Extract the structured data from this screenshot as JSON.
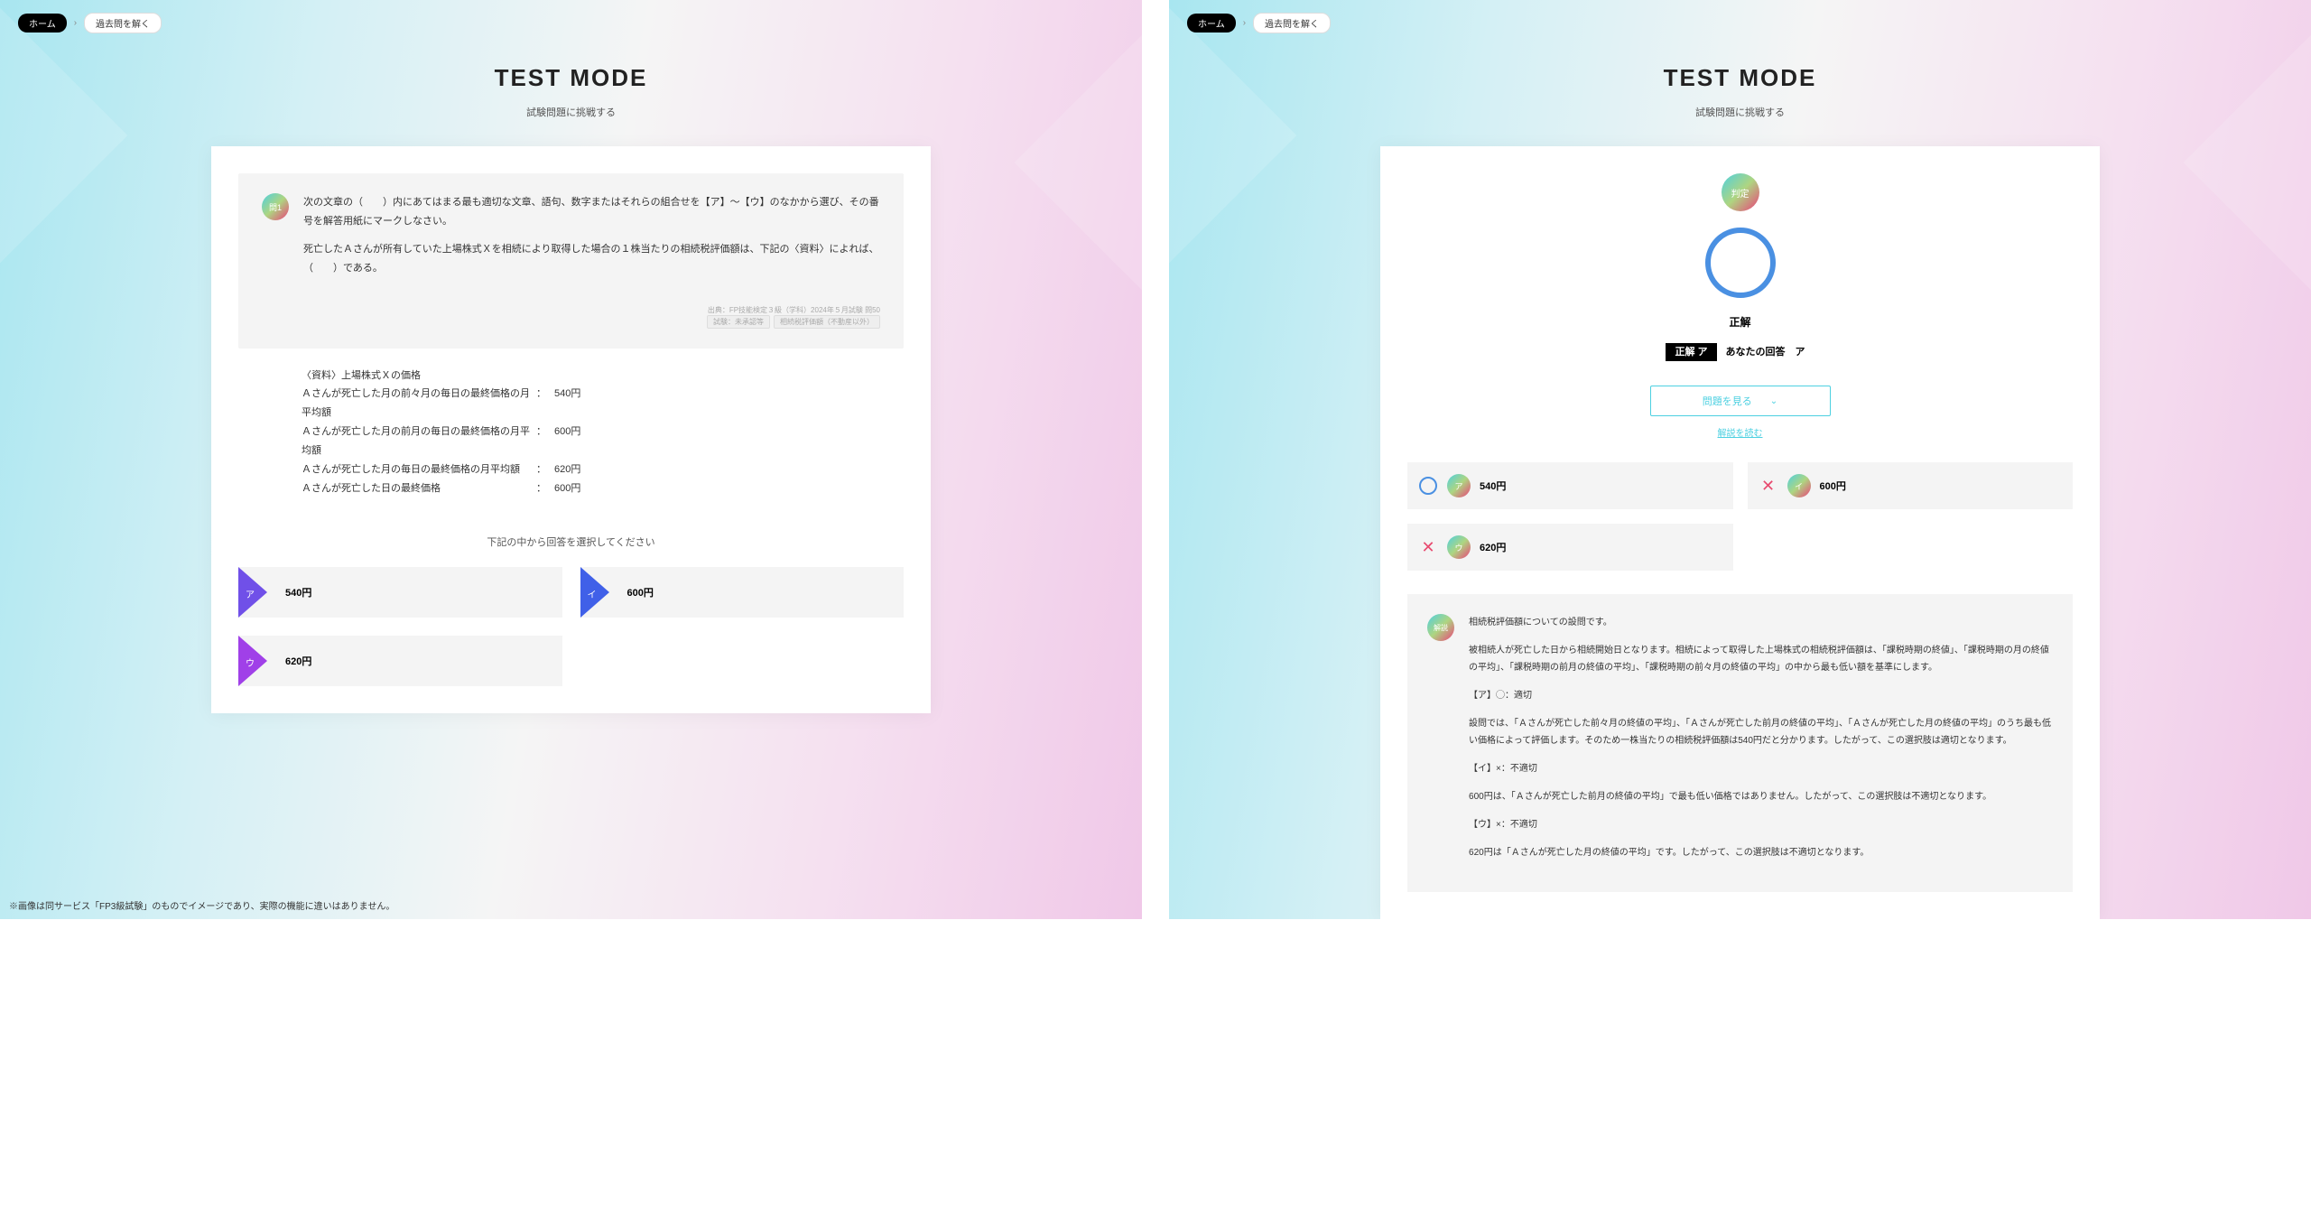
{
  "breadcrumb": {
    "home": "ホーム",
    "current": "過去問を解く"
  },
  "header": {
    "title": "TEST MODE",
    "subtitle": "試験問題に挑戦する"
  },
  "question": {
    "badge": "問1",
    "p1": "次の文章の（　　）内にあてはまる最も適切な文章、語句、数字またはそれらの組合せを【ア】〜【ウ】のなかから選び、その番号を解答用紙にマークしなさい。",
    "p2": "死亡したＡさんが所有していた上場株式Ｘを相続により取得した場合の１株当たりの相続税評価額は、下記の〈資料〉によれば、（　　）である。",
    "meta1": "出典：FP技能検定３級（学科）2024年５月試験 問50",
    "meta2": "試験：未承認等",
    "meta3": "相続税評価額（不動産以外）"
  },
  "data": {
    "title": "〈資料〉上場株式Ｘの価格",
    "rows": [
      {
        "label": "Ａさんが死亡した月の前々月の毎日の最終価格の月平均額",
        "value": "540円"
      },
      {
        "label": "Ａさんが死亡した月の前月の毎日の最終価格の月平均額",
        "value": "600円"
      },
      {
        "label": "Ａさんが死亡した月の毎日の最終価格の月平均額",
        "value": "620円"
      },
      {
        "label": "Ａさんが死亡した日の最終価格",
        "value": "600円"
      }
    ]
  },
  "prompt": "下記の中から回答を選択してください",
  "choices": [
    {
      "letter": "ア",
      "text": "540円"
    },
    {
      "letter": "イ",
      "text": "600円"
    },
    {
      "letter": "ウ",
      "text": "620円"
    }
  ],
  "result": {
    "badge": "判定",
    "label": "正解",
    "correct_prefix": "正解 ア",
    "yours_prefix": "あなたの回答　ア",
    "toggle": "問題を見る",
    "link": "解説を読む"
  },
  "res_choices": [
    {
      "mark": "o",
      "letter": "ア",
      "text": "540円"
    },
    {
      "mark": "x",
      "letter": "イ",
      "text": "600円"
    },
    {
      "mark": "x",
      "letter": "ウ",
      "text": "620円"
    }
  ],
  "explain": {
    "badge": "解説",
    "p1": "相続税評価額についての設問です。",
    "p2": "被相続人が死亡した日から相続開始日となります。相続によって取得した上場株式の相続税評価額は、「課税時期の終値」、「課税時期の月の終値の平均」、「課税時期の前月の終値の平均」、「課税時期の前々月の終値の平均」の中から最も低い額を基準にします。",
    "p3": "【ア】◯：適切",
    "p4": "設問では、「Ａさんが死亡した前々月の終値の平均」、「Ａさんが死亡した前月の終値の平均」、「Ａさんが死亡した月の終値の平均」のうち最も低い価格によって評価します。そのため一株当たりの相続税評価額は540円だと分かります。したがって、この選択肢は適切となります。",
    "p5": "【イ】×：不適切",
    "p6": "600円は、「Ａさんが死亡した前月の終値の平均」で最も低い価格ではありません。したがって、この選択肢は不適切となります。",
    "p7": "【ウ】×：不適切",
    "p8": "620円は「Ａさんが死亡した月の終値の平均」です。したがって、この選択肢は不適切となります。"
  },
  "footnote": "※画像は同サービス「FP3級試験」のものでイメージであり、実際の機能に違いはありません。"
}
